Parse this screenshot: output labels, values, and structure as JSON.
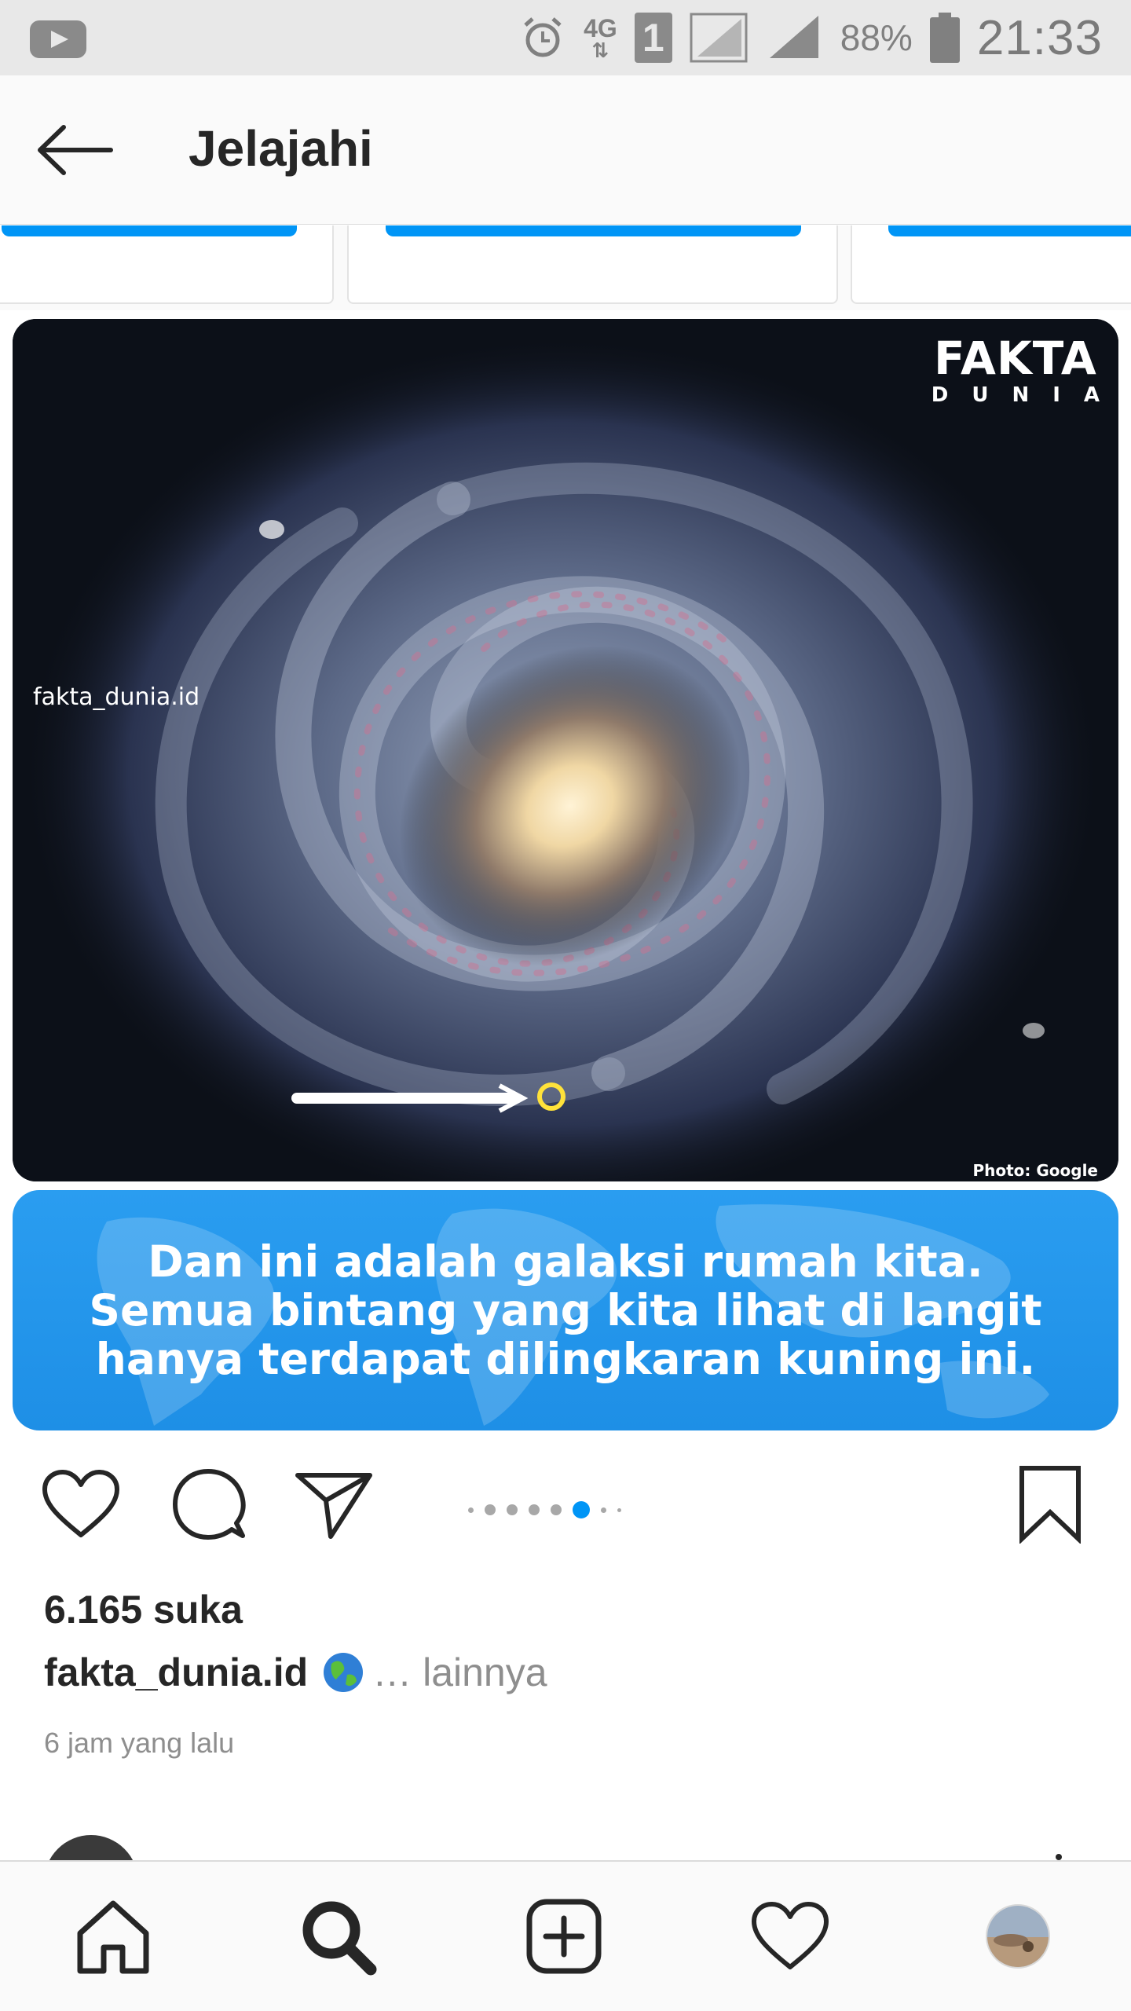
{
  "status_bar": {
    "network": "4G",
    "sim": "1",
    "battery": "88%",
    "time": "21:33"
  },
  "header": {
    "title": "Jelajahi"
  },
  "post": {
    "image": {
      "brand_name": "FAKTA",
      "brand_sub": "DUNIA",
      "watermark": "fakta_dunia.id",
      "credit": "Photo: Google"
    },
    "banner_text": "Dan ini adalah galaksi rumah kita.\nSemua bintang yang kita lihat di langit\nhanya terdapat dilingkaran kuning ini.",
    "carousel": {
      "total": 8,
      "current": 6
    },
    "likes": "6.165 suka",
    "username": "fakta_dunia.id",
    "more_text": "… lainnya",
    "timestamp": "6 jam yang lalu"
  },
  "colors": {
    "accent": "#0095f6",
    "banner": "#2196ec",
    "text": "#262626",
    "muted": "#8e8e8e"
  },
  "icons": {
    "status": [
      "youtube-icon",
      "alarm-icon",
      "signal-icon",
      "battery-icon"
    ],
    "actions": [
      "heart-icon",
      "comment-icon",
      "share-icon",
      "bookmark-icon"
    ],
    "nav": [
      "home-icon",
      "search-icon",
      "add-post-icon",
      "activity-heart-icon",
      "profile-avatar"
    ]
  }
}
